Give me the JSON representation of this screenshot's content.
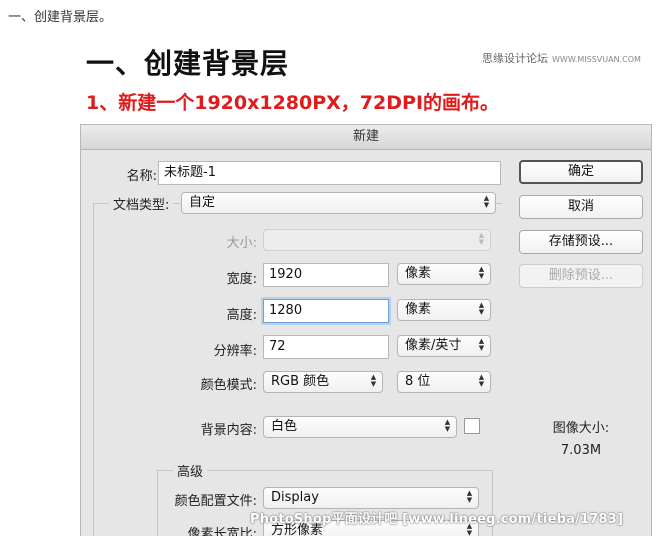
{
  "article": {
    "caption": "一、创建背景层。",
    "heading": "一、创建背景层",
    "step": "1、新建一个1920x1280PX，72DPI的画布。",
    "brand_name": "思缘设计论坛",
    "brand_site": "WWW.MISSVUAN.COM",
    "watermark": "PhotoShop平面设计吧 [www.lineeg.com/tieba/1783]"
  },
  "dialog": {
    "title": "新建",
    "name_label": "名称:",
    "name_value": "未标题-1",
    "doc_type_label": "文档类型:",
    "doc_type_value": "自定",
    "size_label": "大小:",
    "size_value": "",
    "width_label": "宽度:",
    "width_value": "1920",
    "width_unit": "像素",
    "height_label": "高度:",
    "height_value": "1280",
    "height_unit": "像素",
    "resolution_label": "分辨率:",
    "resolution_value": "72",
    "resolution_unit": "像素/英寸",
    "color_mode_label": "颜色模式:",
    "color_mode_value": "RGB 颜色",
    "bit_depth_value": "8 位",
    "background_label": "背景内容:",
    "background_value": "白色",
    "advanced_legend": "高级",
    "color_profile_label": "颜色配置文件:",
    "color_profile_value": "Display",
    "pixel_aspect_label": "像素长宽比:",
    "pixel_aspect_value": "方形像素",
    "image_size_label": "图像大小:",
    "image_size_value": "7.03M",
    "buttons": {
      "ok": "确定",
      "cancel": "取消",
      "save_preset": "存储预设...",
      "delete_preset": "删除预设..."
    },
    "icons": {
      "select_arrows": "up-down-arrows-icon"
    }
  }
}
